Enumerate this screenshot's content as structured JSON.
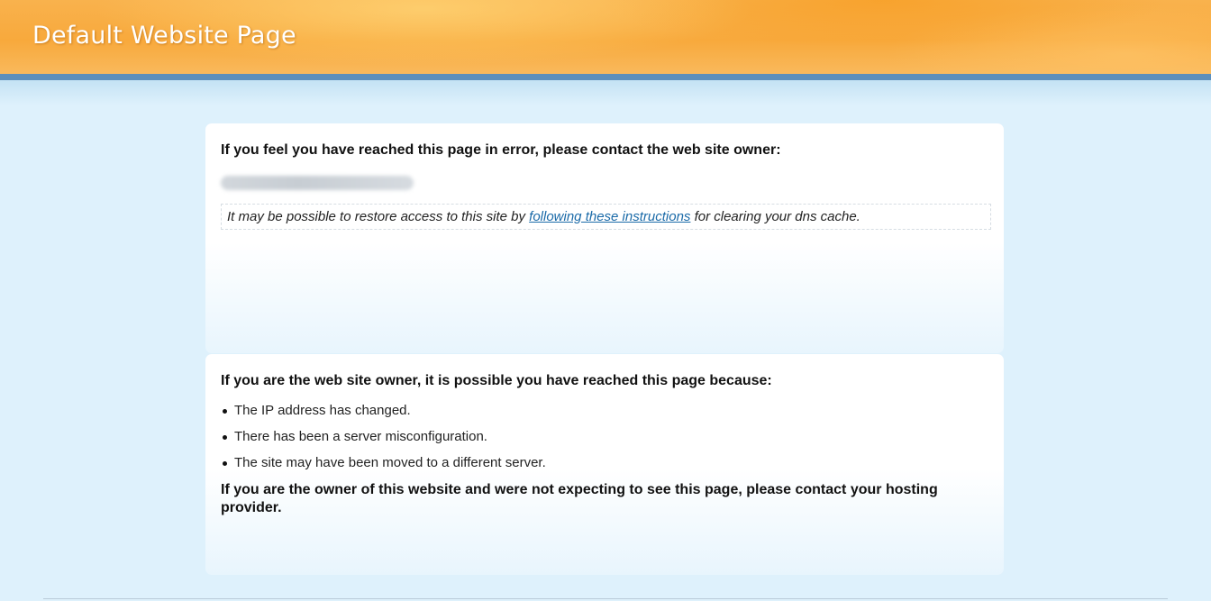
{
  "header": {
    "title": "Default Website Page"
  },
  "error_panel": {
    "heading": "If you feel you have reached this page in error, please contact the web site owner:",
    "dns_note": {
      "prefix": "It may be possible to restore access to this site by ",
      "link_text": "following these instructions",
      "suffix": " for clearing your dns cache."
    }
  },
  "owner_panel": {
    "heading": "If you are the web site owner, it is possible you have reached this page because:",
    "reasons": [
      "The IP address has changed.",
      "There has been a server misconfiguration.",
      "The site may have been moved to a different server."
    ],
    "closing": "If you are the owner of this website and were not expecting to see this page, please contact your hosting provider."
  },
  "colors": {
    "header_orange": "#f8a93c",
    "header_bar_blue": "#5c8fbc",
    "page_background": "#def1fc",
    "link_blue": "#1a6aa8"
  }
}
